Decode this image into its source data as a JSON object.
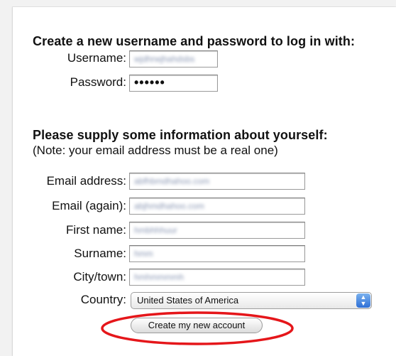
{
  "login_section": {
    "title": "Create a new username and password to log in with:",
    "username_label": "Username:",
    "username_value": "wjdhrwjhahdsbs",
    "password_label": "Password:",
    "password_value": "••••••"
  },
  "info_section": {
    "title": "Please supply some information about yourself:",
    "note": "(Note: your email address must be a real one)",
    "email_label": "Email address:",
    "email_value": "abfhbmdhahoo.com",
    "email_again_label": "Email (again):",
    "email_again_value": "abjhmdhahoo.com",
    "first_name_label": "First name:",
    "first_name_value": "hmbhhhuur",
    "surname_label": "Surname:",
    "surname_value": "hmm",
    "city_label": "City/town:",
    "city_value": "hmhmmmmh",
    "country_label": "Country:",
    "country_value": "United States of America"
  },
  "submit_button_label": "Create my new account",
  "colors": {
    "annotation_red": "#e5161a",
    "select_arrow_blue": "#2e6fd6"
  }
}
